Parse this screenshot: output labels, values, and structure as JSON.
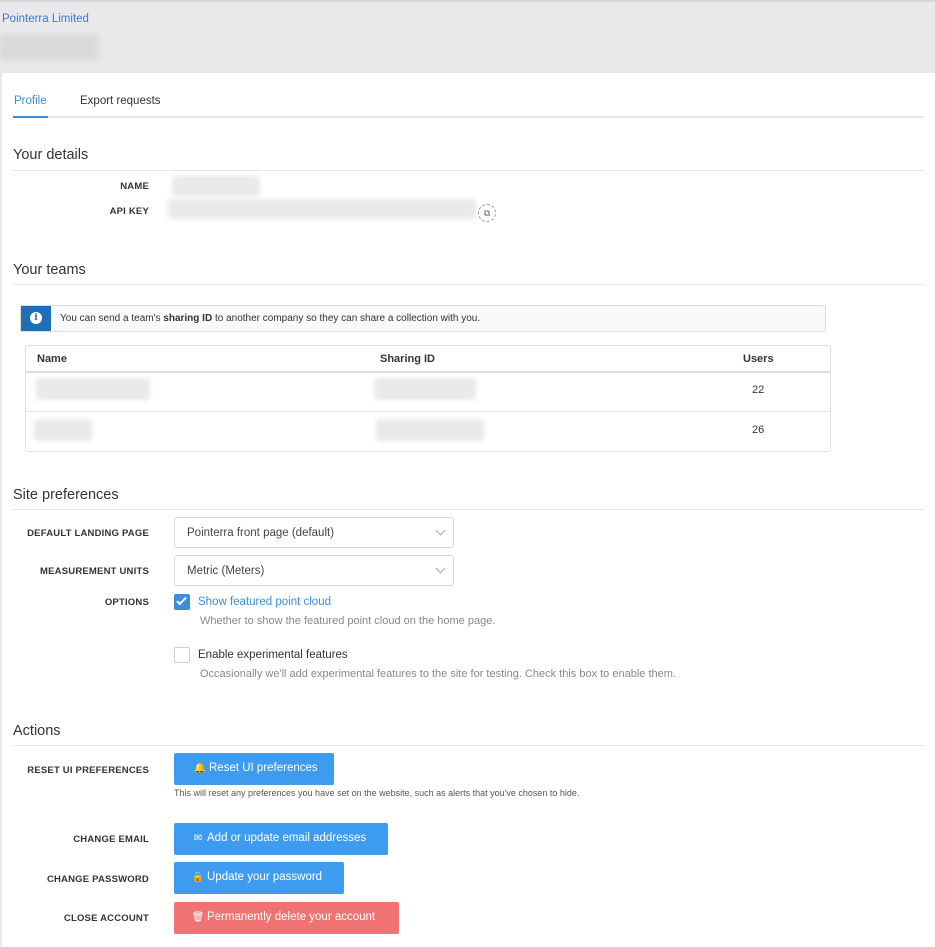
{
  "header": {
    "company": "Pointerra Limited"
  },
  "tabs": [
    {
      "label": "Profile"
    },
    {
      "label": "Export requests"
    }
  ],
  "details": {
    "title": "Your details",
    "name_label": "NAME",
    "api_key_label": "API KEY"
  },
  "teams": {
    "title": "Your teams",
    "info_prefix": "You can send a team's ",
    "info_bold": "sharing ID",
    "info_suffix": " to another company so they can share a collection with you.",
    "columns": [
      "Name",
      "Sharing ID",
      "Users"
    ],
    "rows": [
      {
        "users": "22"
      },
      {
        "users": "26"
      }
    ]
  },
  "preferences": {
    "title": "Site preferences",
    "landing_label": "DEFAULT LANDING PAGE",
    "landing_value": "Pointerra front page (default)",
    "units_label": "MEASUREMENT UNITS",
    "units_value": "Metric (Meters)",
    "options_label": "OPTIONS",
    "options": [
      {
        "label": "Show featured point cloud",
        "description": "Whether to show the featured point cloud on the home page.",
        "checked": true
      },
      {
        "label": "Enable experimental features",
        "description": "Occasionally we'll add experimental features to the site for testing. Check this box to enable them.",
        "checked": false
      }
    ]
  },
  "actions": {
    "title": "Actions",
    "reset_label": "RESET UI PREFERENCES",
    "reset_button": "Reset UI preferences",
    "reset_help": "This will reset any preferences you have set on the website, such as alerts that you've chosen to hide.",
    "email_label": "CHANGE EMAIL",
    "email_button": "Add or update email addresses",
    "password_label": "CHANGE PASSWORD",
    "password_button": "Update your password",
    "close_label": "CLOSE ACCOUNT",
    "close_button": "Permanently delete your account"
  },
  "colors": {
    "accent": "#3a8fd9",
    "button_blue": "#3d9cf0",
    "danger": "#f07272",
    "info_icon_bg": "#1f6fb5"
  },
  "icons": {
    "copy": "copy-icon",
    "info": "info-icon",
    "bell": "bell-icon",
    "envelope": "envelope-icon",
    "lock": "lock-icon",
    "trash": "trash-icon"
  }
}
